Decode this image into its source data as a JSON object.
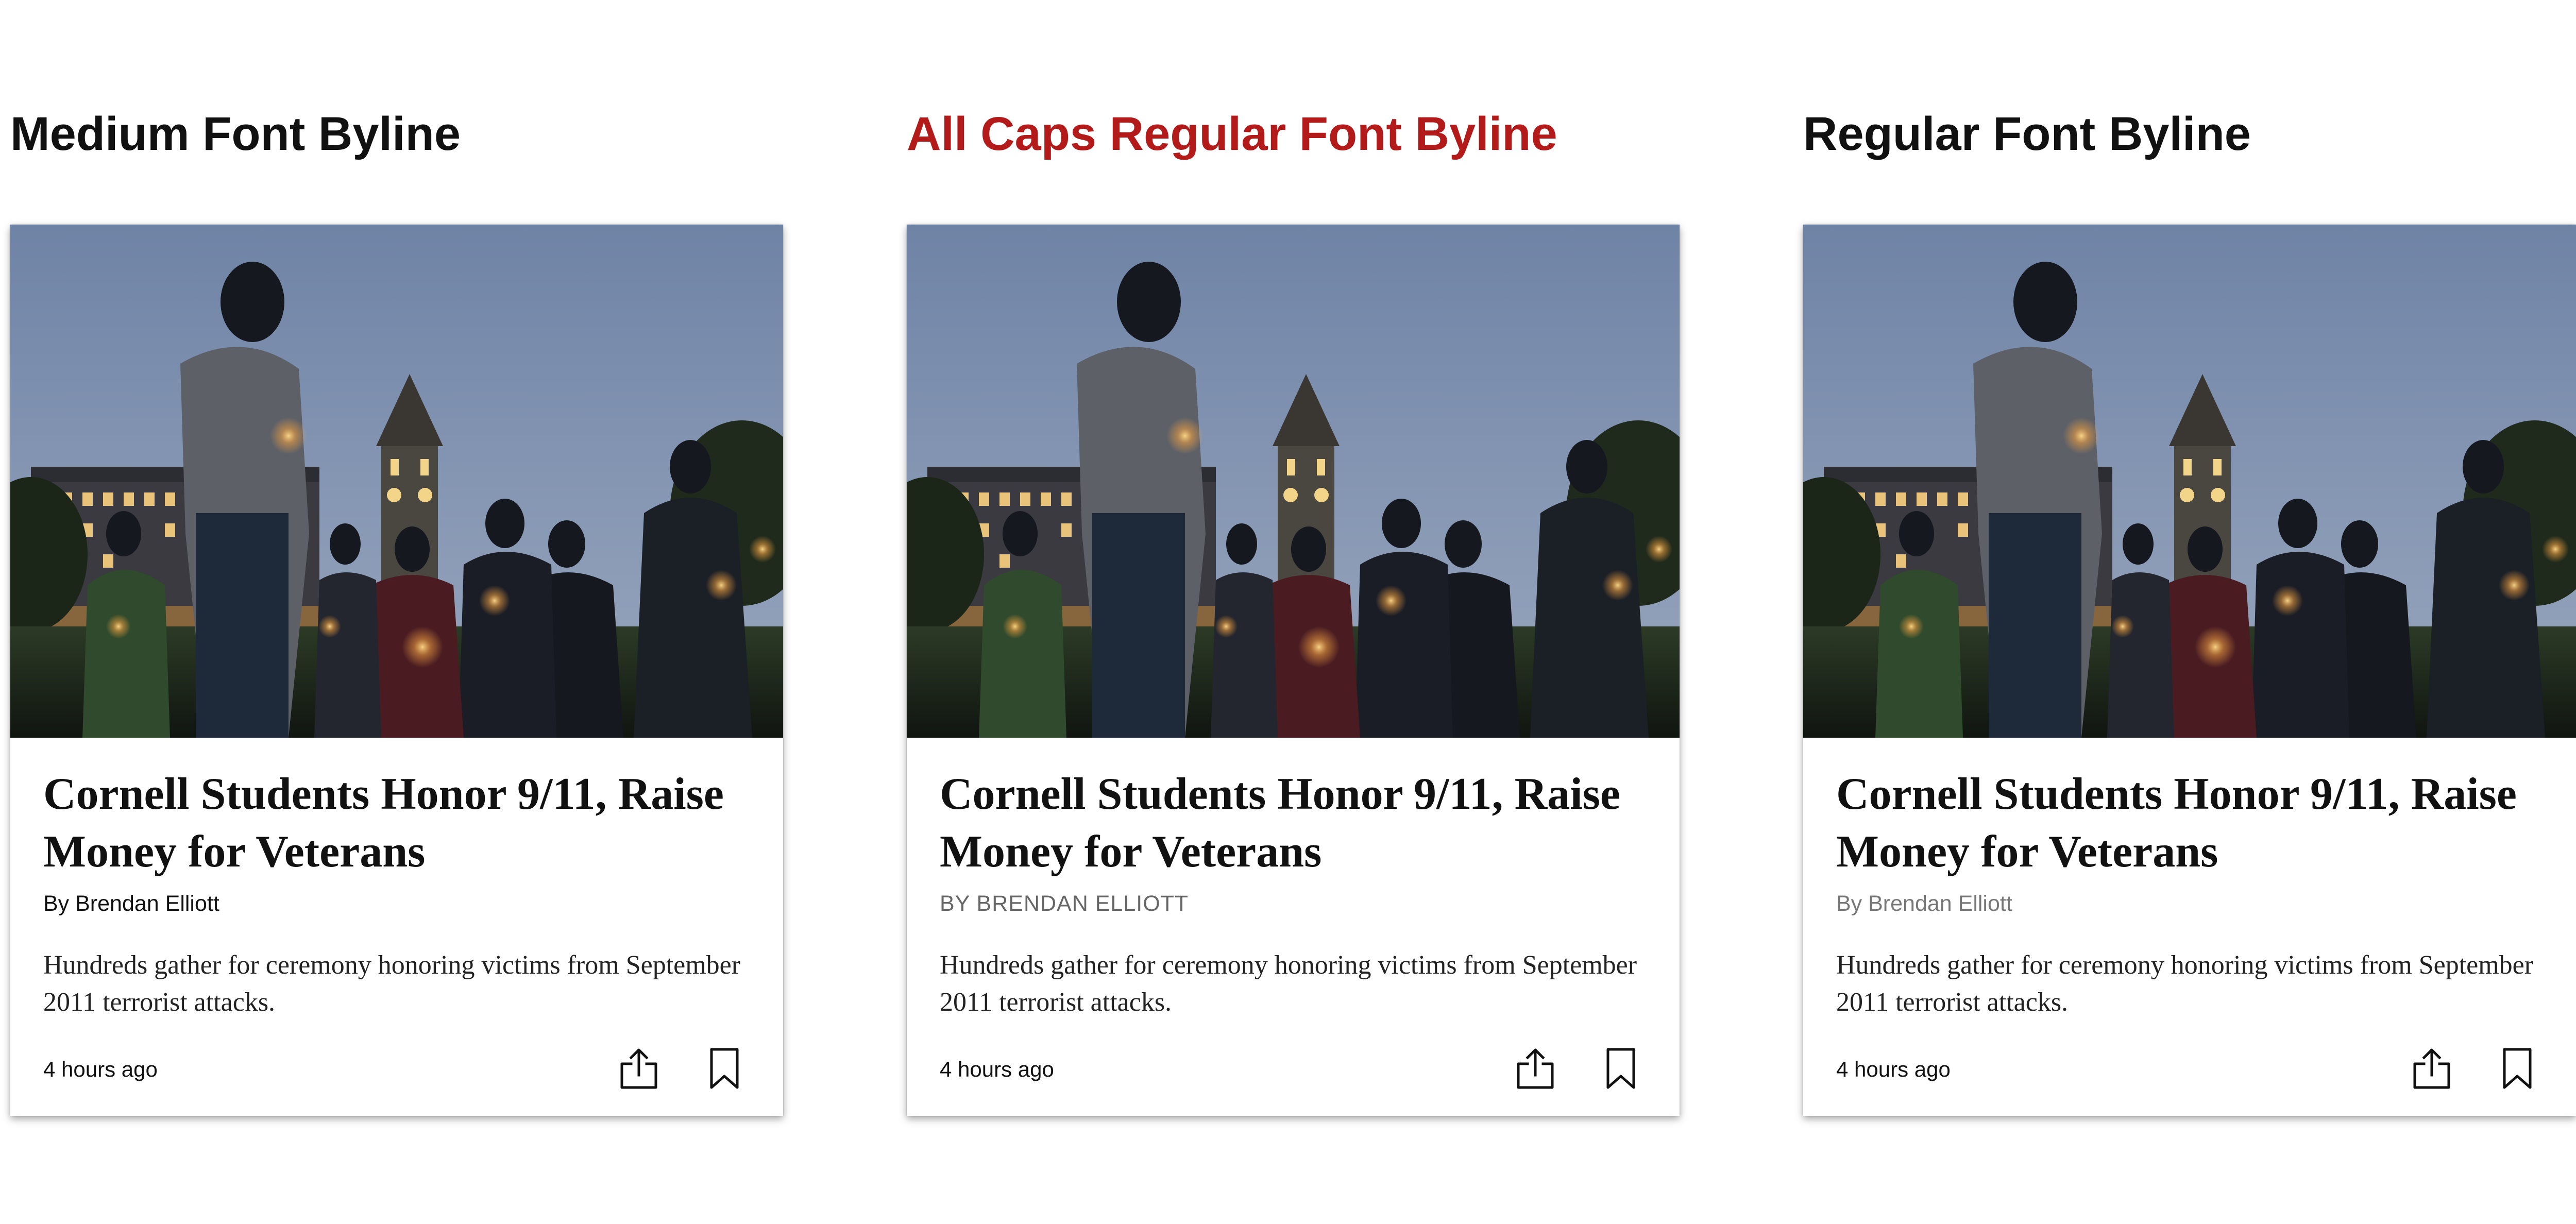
{
  "colors": {
    "accent": "#b31b1b",
    "title": "#111111",
    "byline_muted": "#666666"
  },
  "columns": [
    {
      "section_title": "Medium Font Byline",
      "card": {
        "headline": "Cornell Students Honor 9/11, Raise Money for Veterans",
        "byline": "By Brendan Elliott",
        "summary": "Hundreds gather for ceremony honoring victims from September 2011 terrorist attacks.",
        "timestamp": "4 hours ago",
        "icons": [
          "share-icon",
          "bookmark-icon"
        ]
      }
    },
    {
      "section_title": "All Caps Regular Font Byline",
      "card": {
        "headline": "Cornell Students Honor 9/11, Raise Money for Veterans",
        "byline": "BY BRENDAN ELLIOTT",
        "summary": "Hundreds gather for ceremony honoring victims from September 2011 terrorist attacks.",
        "timestamp": "4 hours ago",
        "icons": [
          "share-icon",
          "bookmark-icon"
        ]
      }
    },
    {
      "section_title": "Regular Font Byline",
      "card": {
        "headline": "Cornell Students Honor 9/11, Raise Money for Veterans",
        "byline": "By Brendan Elliott",
        "summary": "Hundreds gather for ceremony honoring victims from September 2011 terrorist attacks.",
        "timestamp": "4 hours ago",
        "icons": [
          "share-icon",
          "bookmark-icon"
        ]
      }
    }
  ]
}
